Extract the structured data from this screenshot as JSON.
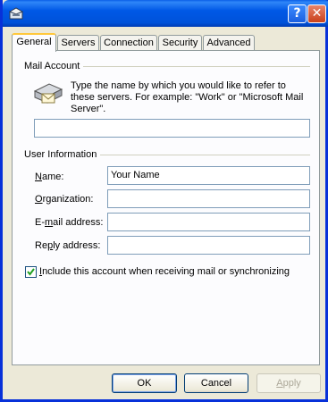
{
  "window": {
    "help_label": "?",
    "close_label": "✕",
    "accent": "#0054e3"
  },
  "tabs": [
    {
      "label": "General",
      "active": true
    },
    {
      "label": "Servers",
      "active": false
    },
    {
      "label": "Connection",
      "active": false
    },
    {
      "label": "Security",
      "active": false
    },
    {
      "label": "Advanced",
      "active": false
    }
  ],
  "mail_account": {
    "group_label": "Mail Account",
    "description": "Type the name by which you would like to refer to these servers.  For example: \"Work\" or \"Microsoft Mail Server\".",
    "icon": "mail-account-icon",
    "value": ""
  },
  "user_info": {
    "group_label": "User Information",
    "name_label_u": "N",
    "name_label_rest": "ame:",
    "name_value": "Your Name",
    "org_label_u": "O",
    "org_label_rest": "rganization:",
    "org_value": "",
    "email_label_pre": "E-",
    "email_label_u": "m",
    "email_label_rest": "ail address:",
    "email_value": "",
    "reply_label_pre": "Re",
    "reply_label_u": "p",
    "reply_label_rest": "ly address:",
    "reply_value": ""
  },
  "include_checkbox": {
    "label_u": "I",
    "label_rest": "nclude this account when receiving mail or synchronizing",
    "checked": true
  },
  "buttons": {
    "ok": "OK",
    "cancel": "Cancel",
    "apply_u": "A",
    "apply_rest": "pply"
  }
}
